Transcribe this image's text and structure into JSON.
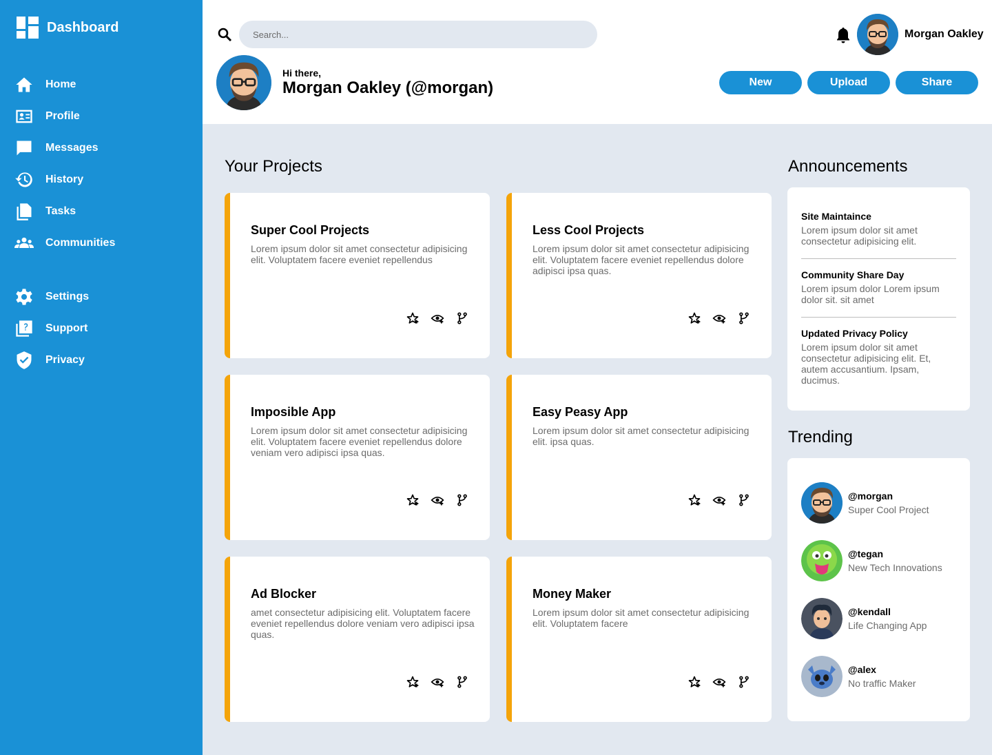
{
  "brand": {
    "title": "Dashboard"
  },
  "nav": {
    "primary": [
      {
        "label": "Home",
        "icon": "home-icon"
      },
      {
        "label": "Profile",
        "icon": "profile-card-icon"
      },
      {
        "label": "Messages",
        "icon": "message-icon"
      },
      {
        "label": "History",
        "icon": "history-icon"
      },
      {
        "label": "Tasks",
        "icon": "tasks-icon"
      },
      {
        "label": "Communities",
        "icon": "communities-icon"
      }
    ],
    "secondary": [
      {
        "label": "Settings",
        "icon": "gear-icon"
      },
      {
        "label": "Support",
        "icon": "support-icon"
      },
      {
        "label": "Privacy",
        "icon": "shield-icon"
      }
    ]
  },
  "header": {
    "search_placeholder": "Search...",
    "username": "Morgan Oakley",
    "greeting": "Hi there,",
    "full_name": "Morgan Oakley (@morgan)",
    "buttons": {
      "new": "New",
      "upload": "Upload",
      "share": "Share"
    }
  },
  "projects": {
    "title": "Your Projects",
    "items": [
      {
        "title": "Super Cool Projects",
        "desc": "Lorem ipsum dolor sit amet consectetur adipisicing elit. Voluptatem facere eveniet repellendus"
      },
      {
        "title": "Less Cool Projects",
        "desc": "Lorem ipsum dolor sit amet consectetur adipisicing elit. Voluptatem facere eveniet repellendus dolore adipisci ipsa quas."
      },
      {
        "title": "Imposible App",
        "desc": "Lorem ipsum dolor sit amet consectetur adipisicing elit. Voluptatem facere eveniet repellendus dolore veniam vero adipisci ipsa quas."
      },
      {
        "title": "Easy Peasy App",
        "desc": "Lorem ipsum dolor sit amet consectetur adipisicing elit. ipsa quas."
      },
      {
        "title": "Ad Blocker",
        "desc": "amet consectetur adipisicing elit. Voluptatem facere eveniet repellendus dolore veniam vero adipisci ipsa quas."
      },
      {
        "title": "Money Maker",
        "desc": "Lorem ipsum dolor sit amet consectetur adipisicing elit. Voluptatem facere"
      }
    ]
  },
  "announcements": {
    "title": "Announcements",
    "items": [
      {
        "title": "Site Maintaince",
        "text": "Lorem ipsum dolor sit amet consectetur adipisicing elit."
      },
      {
        "title": "Community Share Day",
        "text": "Lorem ipsum dolor Lorem ipsum dolor sit. sit amet"
      },
      {
        "title": "Updated Privacy Policy",
        "text": "Lorem ipsum dolor sit amet consectetur adipisicing elit. Et, autem accusantium. Ipsam, ducimus."
      }
    ]
  },
  "trending": {
    "title": "Trending",
    "items": [
      {
        "handle": "@morgan",
        "project": "Super Cool Project"
      },
      {
        "handle": "@tegan",
        "project": "New Tech Innovations"
      },
      {
        "handle": "@kendall",
        "project": "Life Changing App"
      },
      {
        "handle": "@alex",
        "project": "No traffic Maker"
      }
    ]
  },
  "colors": {
    "accent": "#1a91d6",
    "card_border": "#f4a40a",
    "background": "#e2e8f0"
  }
}
